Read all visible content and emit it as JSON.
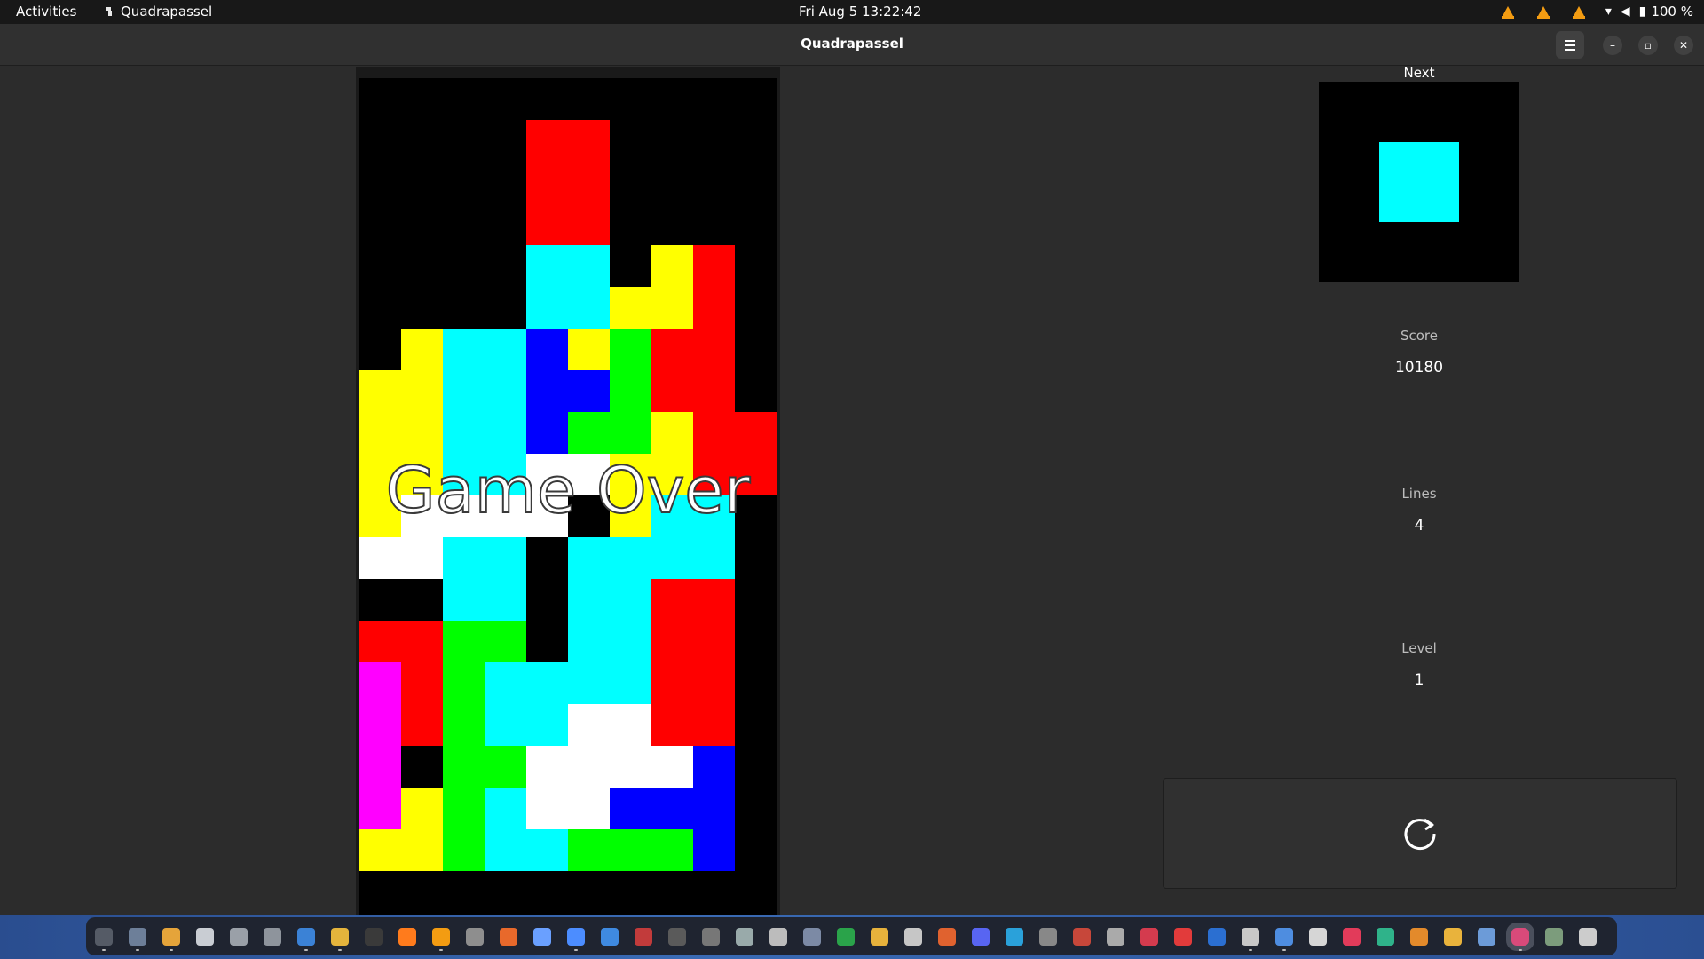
{
  "topbar": {
    "activities": "Activities",
    "app_name": "Quadrapassel",
    "clock": "Fri Aug 5  13:22:42",
    "battery": "100 %"
  },
  "window": {
    "title": "Quadrapassel"
  },
  "game": {
    "status": "Game Over",
    "columns": 10,
    "rows": 20,
    "colors": {
      "R": "#ff0000",
      "C": "#00ffff",
      "Y": "#ffff00",
      "B": "#0000ff",
      "G": "#00ff00",
      "W": "#ffffff",
      "M": "#ff00ff"
    },
    "board": [
      "..........",
      "....RR....",
      "....RR....",
      "....RR....",
      "....CC.YR.",
      "....CCYYR.",
      ".YCCBYGRR.",
      "YYCCBBGRR.",
      "YYCCBGGYRR",
      "YYCCWWYYRR",
      "YWWWW.YCC.",
      "WWCC.CCCC.",
      "..CC.CCRR.",
      "RRGG.CCRR.",
      "MRGCCCCRR.",
      "MRGCCWWRR.",
      "M.GGWWWWB.",
      "MYGCWWBBB.",
      "YYGCCGGGB.",
      ".........."
    ]
  },
  "panel": {
    "next_label": "Next",
    "next_piece_color": "#00ffff",
    "score_label": "Score",
    "score_value": "10180",
    "lines_label": "Lines",
    "lines_value": "4",
    "level_label": "Level",
    "level_value": "1",
    "new_game_icon": "restart-icon"
  },
  "dock": {
    "apps": [
      {
        "name": "system-monitor",
        "color": "#555b66",
        "running": true
      },
      {
        "name": "files",
        "color": "#6d7f99",
        "running": true
      },
      {
        "name": "chrome",
        "color": "#e5a43a",
        "running": true
      },
      {
        "name": "text-editor",
        "color": "#c9cdd3",
        "running": false
      },
      {
        "name": "archive",
        "color": "#9aa0a8",
        "running": false
      },
      {
        "name": "screenshot",
        "color": "#8e949c",
        "running": false
      },
      {
        "name": "writer",
        "color": "#3b82d6",
        "running": true
      },
      {
        "name": "notes",
        "color": "#e4b43c",
        "running": true
      },
      {
        "name": "terminal",
        "color": "#3a3a3a",
        "running": false
      },
      {
        "name": "firefox",
        "color": "#ff7b1c",
        "running": false
      },
      {
        "name": "vlc",
        "color": "#f39c12",
        "running": true
      },
      {
        "name": "obs",
        "color": "#8e8e8e",
        "running": false
      },
      {
        "name": "software",
        "color": "#e8692b",
        "running": false
      },
      {
        "name": "editor",
        "color": "#6aa0ff",
        "running": false
      },
      {
        "name": "docs",
        "color": "#4c8dff",
        "running": true
      },
      {
        "name": "help",
        "color": "#3f8ae0",
        "running": false
      },
      {
        "name": "monitor",
        "color": "#c23b3b",
        "running": false
      },
      {
        "name": "camera",
        "color": "#5a5a5a",
        "running": false
      },
      {
        "name": "tweaks",
        "color": "#777",
        "running": false
      },
      {
        "name": "up-arrow",
        "color": "#9aa",
        "running": false
      },
      {
        "name": "box",
        "color": "#bcbcbc",
        "running": false
      },
      {
        "name": "screen-rec",
        "color": "#7c8aa5",
        "running": false
      },
      {
        "name": "calc",
        "color": "#2aa34a",
        "running": false
      },
      {
        "name": "slides",
        "color": "#e7b23c",
        "running": false
      },
      {
        "name": "music",
        "color": "#c6c6c6",
        "running": false
      },
      {
        "name": "impress",
        "color": "#e0622f",
        "running": false
      },
      {
        "name": "discord",
        "color": "#5865f2",
        "running": false
      },
      {
        "name": "telegram",
        "color": "#2aa1da",
        "running": false
      },
      {
        "name": "clock",
        "color": "#888",
        "running": false
      },
      {
        "name": "pdf",
        "color": "#c7473a",
        "running": false
      },
      {
        "name": "percent",
        "color": "#aaa",
        "running": false
      },
      {
        "name": "screen",
        "color": "#d43b4e",
        "running": false
      },
      {
        "name": "gift",
        "color": "#e23b3b",
        "running": false
      },
      {
        "name": "word",
        "color": "#2b6fd1",
        "running": false
      },
      {
        "name": "steam",
        "color": "#c8c8c8",
        "running": true
      },
      {
        "name": "doc2",
        "color": "#4e8de0",
        "running": true
      },
      {
        "name": "disk",
        "color": "#d6d6d6",
        "running": false
      },
      {
        "name": "heart",
        "color": "#e23b5a",
        "running": false
      },
      {
        "name": "calendar",
        "color": "#2fb38a",
        "running": false
      },
      {
        "name": "person",
        "color": "#e38a2b",
        "running": false
      },
      {
        "name": "chat",
        "color": "#e9b33c",
        "running": false
      },
      {
        "name": "connect",
        "color": "#6c9bd8",
        "running": false
      },
      {
        "name": "quadrapassel",
        "color": "#d94a7a",
        "running": true,
        "active": true
      },
      {
        "name": "trash",
        "color": "#7c9c7c",
        "running": false
      },
      {
        "name": "app-grid",
        "color": "#cccccc",
        "running": false
      }
    ]
  }
}
